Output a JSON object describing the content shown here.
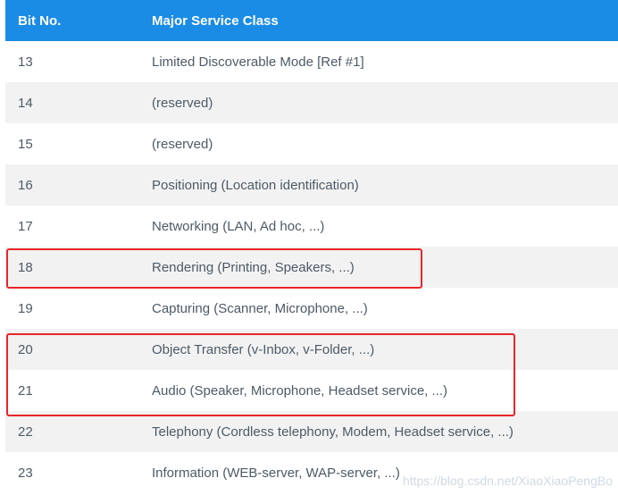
{
  "table": {
    "headers": {
      "bit": "Bit No.",
      "class": "Major Service Class"
    },
    "rows": [
      {
        "bit": "13",
        "class": "Limited Discoverable Mode [Ref #1]"
      },
      {
        "bit": "14",
        "class": "(reserved)"
      },
      {
        "bit": "15",
        "class": "(reserved)"
      },
      {
        "bit": "16",
        "class": "Positioning (Location identification)"
      },
      {
        "bit": "17",
        "class": "Networking (LAN, Ad hoc, ...)"
      },
      {
        "bit": "18",
        "class": "Rendering (Printing, Speakers, ...)"
      },
      {
        "bit": "19",
        "class": "Capturing (Scanner, Microphone, ...)"
      },
      {
        "bit": "20",
        "class": "Object Transfer (v-Inbox, v-Folder, ...)"
      },
      {
        "bit": "21",
        "class": "Audio (Speaker, Microphone, Headset service, ...)"
      },
      {
        "bit": "22",
        "class": "Telephony (Cordless telephony, Modem, Headset service, ...)"
      },
      {
        "bit": "23",
        "class": "Information (WEB-server, WAP-server, ...)"
      }
    ]
  },
  "highlight_color": "#e8262a",
  "header_color": "#1a8ce6",
  "watermark": "https://blog.csdn.net/XiaoXiaoPengBo"
}
